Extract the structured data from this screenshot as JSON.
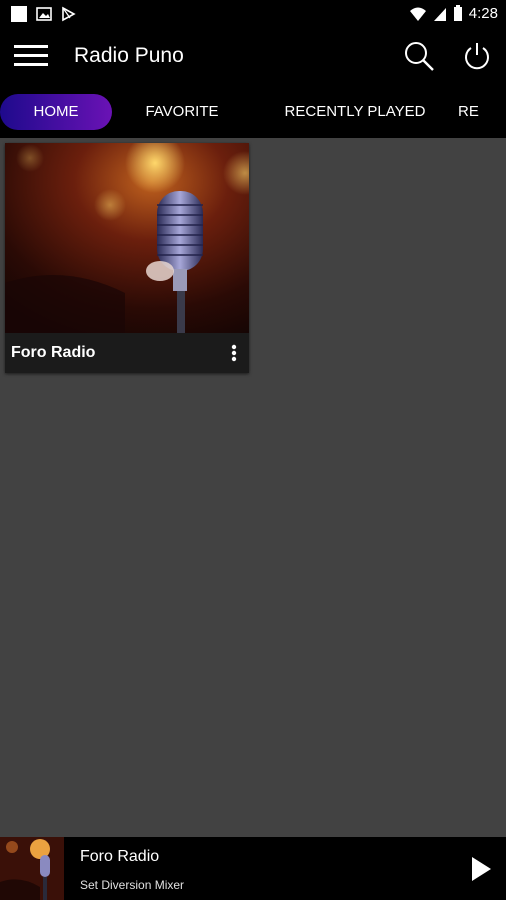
{
  "status_bar": {
    "time": "4:28",
    "icons": [
      "notification-square-icon",
      "image-icon",
      "play-store-icon",
      "wifi-icon",
      "signal-icon",
      "battery-icon"
    ]
  },
  "toolbar": {
    "title": "Radio Puno",
    "icons": [
      "hamburger-menu-icon",
      "search-icon",
      "power-icon"
    ]
  },
  "tabs": [
    {
      "label": "HOME",
      "active": true
    },
    {
      "label": "FAVORITE",
      "active": false
    },
    {
      "label": "RECENTLY PLAYED",
      "active": false
    },
    {
      "label": "RE",
      "active": false
    }
  ],
  "stations": [
    {
      "name": "Foro Radio"
    }
  ],
  "player": {
    "title": "Foro Radio",
    "subtitle": "Set Diversion Mixer"
  },
  "colors": {
    "background": "#424242",
    "bars": "#000000",
    "tab_active_start": "#1e0a8c",
    "tab_active_end": "#6a12b5"
  }
}
